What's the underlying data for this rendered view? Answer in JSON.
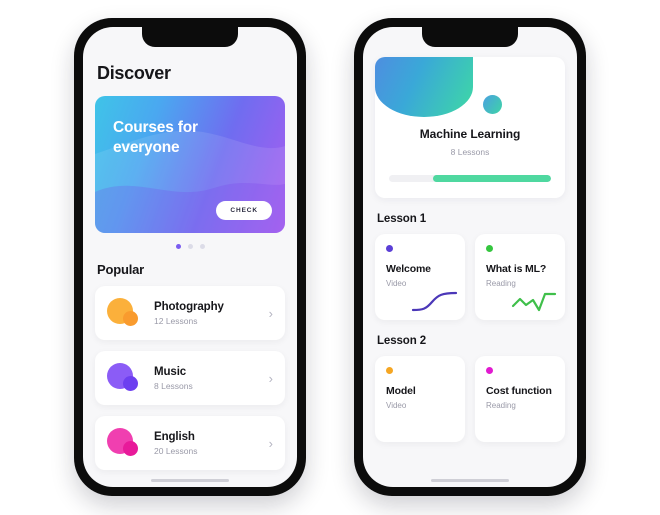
{
  "phone_left": {
    "page_title": "Discover",
    "banner": {
      "title": "Courses for\neveryone",
      "cta_label": "CHECK",
      "gradient_from": "#3fc4e8",
      "gradient_to": "#a95cf0"
    },
    "carousel": {
      "dots": 3,
      "active_index": 0,
      "active_color": "#7a5cf0",
      "inactive_color": "#dcdce8"
    },
    "section_title": "Popular",
    "courses": [
      {
        "name": "Photography",
        "lessons": "12 Lessons",
        "color_main": "#fbb03b",
        "color_accent": "#f99b2e",
        "chevron": "chevron-right-icon"
      },
      {
        "name": "Music",
        "lessons": "8 Lessons",
        "color_main": "#8b5cf6",
        "color_accent": "#6d3ff0",
        "chevron": "chevron-right-icon"
      },
      {
        "name": "English",
        "lessons": "20 Lessons",
        "color_main": "#f03fb0",
        "color_accent": "#e81a9a",
        "chevron": "chevron-right-icon"
      }
    ]
  },
  "phone_right": {
    "hero": {
      "title": "Machine Learning",
      "lessons": "8 Lessons",
      "deco_shape": "half-circle-decoration",
      "deco_gradient_from": "#4e8ee0",
      "deco_gradient_to": "#3ed9a4",
      "progress_percent": 73,
      "progress_color": "#4fd8a0",
      "progress_track_color": "#f0f0f3"
    },
    "lessons": [
      {
        "label": "Lesson 1",
        "cards": [
          {
            "title": "Welcome",
            "type": "Video",
            "dot_color": "#5b3fd6",
            "graphic": "sigmoid-curve-graphic",
            "graphic_color": "#4b37b8"
          },
          {
            "title": "What is ML?",
            "type": "Reading",
            "dot_color": "#35c63f",
            "graphic": "line-chart-graphic",
            "graphic_color": "#3fbf4a"
          }
        ]
      },
      {
        "label": "Lesson 2",
        "cards": [
          {
            "title": "Model",
            "type": "Video",
            "dot_color": "#f5a623",
            "graphic": "none",
            "graphic_color": "#f5a623"
          },
          {
            "title": "Cost function",
            "type": "Reading",
            "dot_color": "#e11ad0",
            "graphic": "none",
            "graphic_color": "#e11ad0"
          }
        ]
      }
    ]
  }
}
